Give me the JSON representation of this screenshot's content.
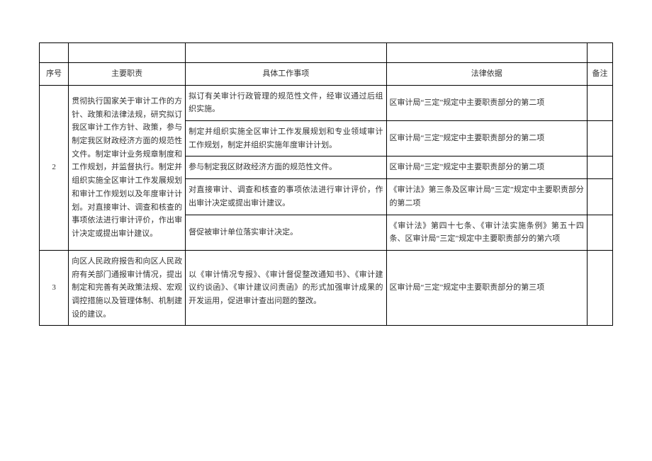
{
  "headers": {
    "seq": "序号",
    "duty": "主要职责",
    "work": "具体工作事项",
    "law": "法律依据",
    "remark": "备注"
  },
  "rows": [
    {
      "seq": "2",
      "duty": "贯彻执行国家关于审计工作的方针、政策和法律法规，研究拟订我区审计工作方针、政策，参与制定我区财政经济方面的规范性文件。制定审计业务规章制度和工作规划，并监督执行。制定并组织实施全区审计工作发展规划和审计工作规划以及年度审计计划。对直接审计、调查和核查的事项依法进行审计评价，作出审计决定或提出审计建议。",
      "subrows": [
        {
          "work": "拟订有关审计行政管理的规范性文件，经审议通过后组织实施。",
          "law": "区审计局“三定”规定中主要职责部分的第二项",
          "remark": ""
        },
        {
          "work": "制定并组织实施全区审计工作发展规划和专业领域审计工作规划，制定并组织实施年度审计计划。",
          "law": "区审计局“三定”规定中主要职责部分的第二项",
          "remark": ""
        },
        {
          "work": "参与制定我区财政经济方面的规范性文件。",
          "law": "区审计局“三定”规定中主要职责部分的第二项",
          "remark": ""
        },
        {
          "work": "对直接审计、调查和核查的事项依法进行审计评价，作出审计决定或提出审计建议。",
          "law": "《审计法》第三条及区审计局“三定”规定中主要职责部分的第二项",
          "remark": ""
        },
        {
          "work": "督促被审计单位落实审计决定。",
          "law": "《审计法》第四十七条、《审计法实施条例》第五十四条、区审计局“三定”规定中主要职责部分的第六项",
          "remark": ""
        }
      ]
    },
    {
      "seq": "3",
      "duty": "向区人民政府报告和向区人民政府有关部门通报审计情况，提出制定和完善有关政策法规、宏观调控措施以及管理体制、机制建设的建议。",
      "subrows": [
        {
          "work": "以《审计情况专报》、《审计督促整改通知书》、《审计建议约谈函》、《审计建议问责函》的形式加强审计成果的开发运用，促进审计查出问题的整改。",
          "law": "区审计局“三定”规定中主要职责部分的第三项",
          "remark": ""
        }
      ]
    }
  ]
}
